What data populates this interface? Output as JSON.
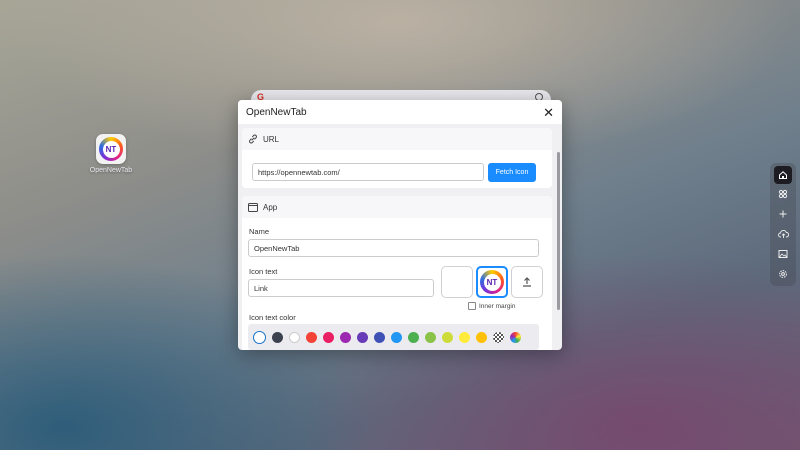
{
  "desktop": {
    "app_label": "OpenNewTab",
    "logo_text": "NT"
  },
  "dialog": {
    "title": "OpenNewTab",
    "close_icon": "close-icon",
    "url_section": {
      "title": "URL",
      "icon": "link-icon",
      "url_value": "https://opennewtab.com/",
      "fetch_label": "Fetch Icon"
    },
    "app_section": {
      "title": "App",
      "icon": "window-icon",
      "name_label": "Name",
      "name_value": "OpenNewTab",
      "icon_text_label": "Icon text",
      "icon_text_value": "Link",
      "inner_margin_label": "Inner margin",
      "icon_text_color_label": "Icon text color",
      "swatches": [
        "#ffffff",
        "#3c4150",
        "#ffffff",
        "#f44336",
        "#e91e63",
        "#9c27b0",
        "#673ab7",
        "#3f51b5",
        "#2196f3",
        "#4caf50",
        "#8bc34a",
        "#cddc39",
        "#ffeb3b",
        "#ffc107",
        "checker",
        "spectrum"
      ]
    }
  },
  "sidebar": {
    "items": [
      "home-icon",
      "apps-icon",
      "plus-icon",
      "upload-icon",
      "wallpaper-icon",
      "settings-icon"
    ]
  },
  "accent": "#1a8cff"
}
